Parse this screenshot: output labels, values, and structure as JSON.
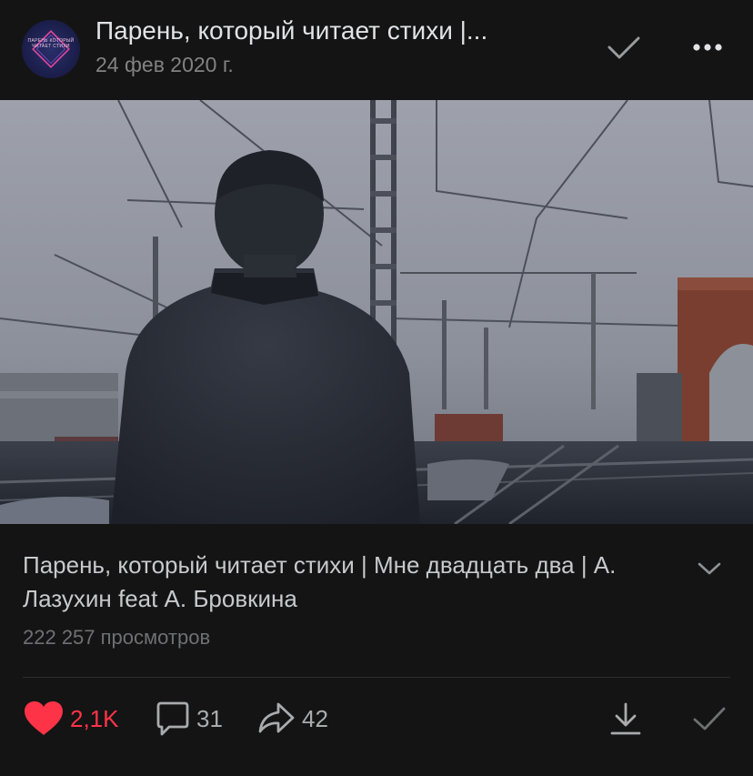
{
  "header": {
    "avatar_text": "ПАРЕНЬ КОТОРЫЙ ЧИТАЕТ СТИХИ",
    "title": "Парень, который читает стихи |...",
    "date": "24 фев 2020 г."
  },
  "video": {
    "title": "Парень, который читает стихи | Мне двадцать два | А. Лазухин feat А. Бровкина",
    "views": "222 257 просмотров"
  },
  "actions": {
    "likes": "2,1K",
    "comments": "31",
    "shares": "42"
  },
  "colors": {
    "background": "#141414",
    "like": "#ff3347",
    "text_primary": "#e1e3e6",
    "text_secondary": "#828282"
  }
}
